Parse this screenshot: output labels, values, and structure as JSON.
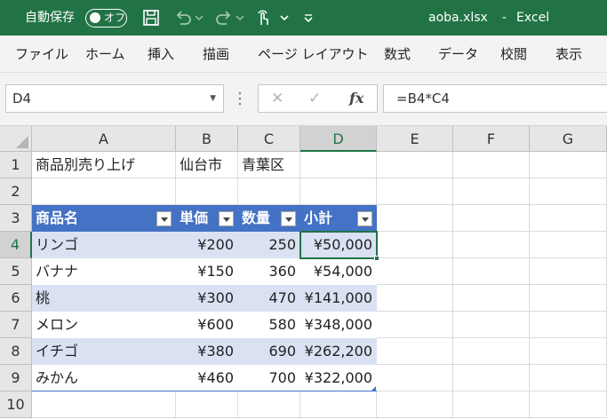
{
  "titlebar": {
    "autosave_label": "自動保存",
    "autosave_state": "オフ",
    "filename": "aoba.xlsx",
    "separator": "-",
    "app_name": "Excel"
  },
  "ribbon": {
    "tabs": [
      "ファイル",
      "ホーム",
      "挿入",
      "描画",
      "ページ レイアウト",
      "数式",
      "データ",
      "校閲",
      "表示"
    ]
  },
  "formula_bar": {
    "name_box": "D4",
    "formula": "=B4*C4",
    "fx_label": "fx"
  },
  "grid": {
    "columns": [
      "A",
      "B",
      "C",
      "D",
      "E",
      "F",
      "G"
    ],
    "rows": [
      "1",
      "2",
      "3",
      "4",
      "5",
      "6",
      "7",
      "8",
      "9",
      "10"
    ],
    "cells": {
      "A1": "商品別売り上げ",
      "B1": "仙台市",
      "C1": "青葉区",
      "A3": "商品名",
      "B3": "単価",
      "C3": "数量",
      "D3": "小計",
      "A4": "リンゴ",
      "B4": "¥200",
      "C4": "250",
      "D4": "¥50,000",
      "A5": "バナナ",
      "B5": "¥150",
      "C5": "360",
      "D5": "¥54,000",
      "A6": "桃",
      "B6": "¥300",
      "C6": "470",
      "D6": "¥141,000",
      "A7": "メロン",
      "B7": "¥600",
      "C7": "580",
      "D7": "¥348,000",
      "A8": "イチゴ",
      "B8": "¥380",
      "C8": "690",
      "D8": "¥262,200",
      "A9": "みかん",
      "B9": "¥460",
      "C9": "700",
      "D9": "¥322,000"
    },
    "active_cell": "D4",
    "colors": {
      "accent": "#217346",
      "table_header": "#4472c4",
      "table_band": "#d9e1f2"
    }
  }
}
